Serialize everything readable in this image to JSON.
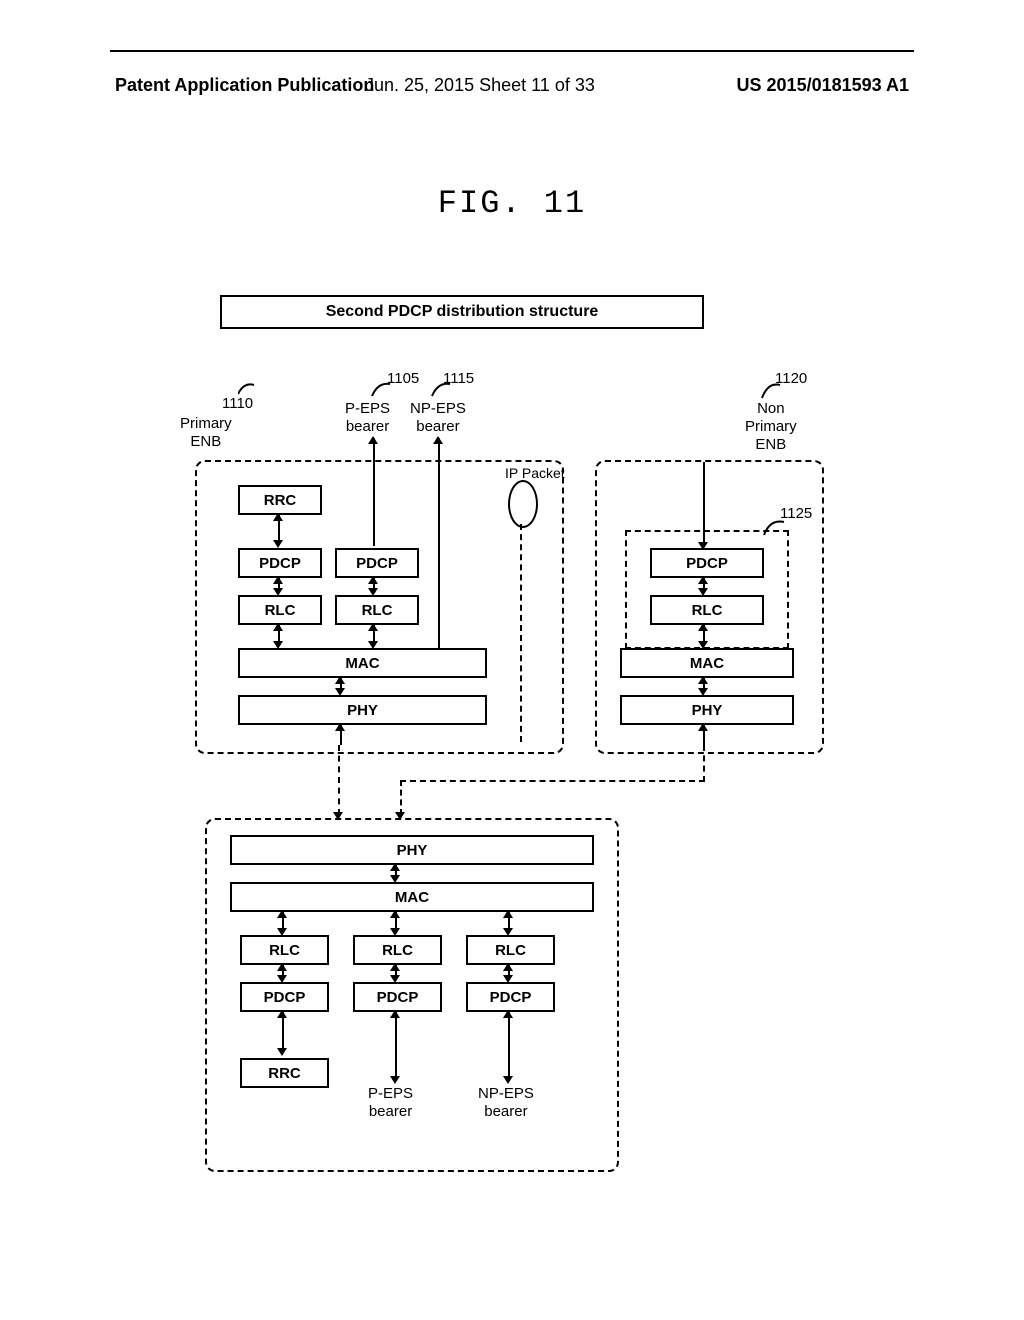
{
  "header": {
    "left": "Patent Application Publication",
    "mid": "Jun. 25, 2015  Sheet 11 of 33",
    "right": "US 2015/0181593 A1"
  },
  "figure": {
    "title": "FIG. 11",
    "box_title": "Second PDCP distribution structure"
  },
  "labels": {
    "n1110": "1110",
    "primary_enb": "Primary\nENB",
    "n1105": "1105",
    "peps": "P-EPS\nbearer",
    "n1115": "1115",
    "npeps": "NP-EPS\nbearer",
    "n1120": "1120",
    "non_primary_enb": "Non\nPrimary\nENB",
    "n1125": "1125",
    "ip_packet": "IP Packet"
  },
  "blocks": {
    "rrc": "RRC",
    "pdcp": "PDCP",
    "rlc": "RLC",
    "mac": "MAC",
    "phy": "PHY"
  },
  "bottom_labels": {
    "rrc": "RRC",
    "peps": "P-EPS\nbearer",
    "npeps": "NP-EPS\nbearer"
  }
}
